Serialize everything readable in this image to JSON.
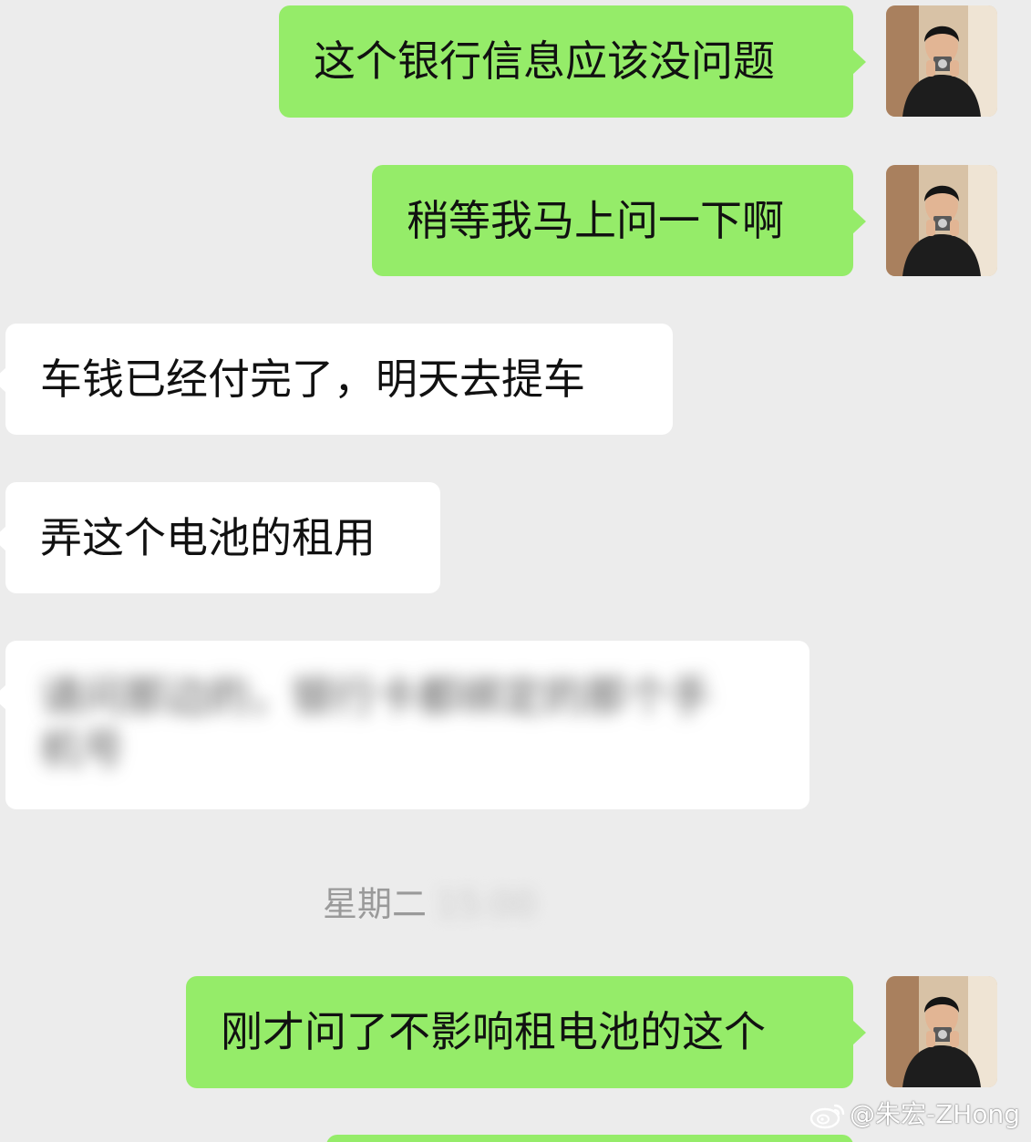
{
  "messages": [
    {
      "side": "out",
      "text": "这个银行信息应该没问题"
    },
    {
      "side": "out",
      "text": "稍等我马上问一下啊"
    },
    {
      "side": "in",
      "text": "车钱已经付完了，明天去提车"
    },
    {
      "side": "in",
      "text": "弄这个电池的租用"
    },
    {
      "side": "in",
      "line1": "请问那边的，银行卡都绑定的那个手",
      "line2": "机号"
    },
    {
      "side": "out",
      "text": "刚才问了不影响租电池的这个"
    }
  ],
  "timestamp": {
    "day": "星期二",
    "time": "15:00"
  },
  "watermark": {
    "text": "@朱宏-ZHong"
  },
  "colors": {
    "background": "#ececec",
    "outgoing_bubble": "#95ec69",
    "incoming_bubble": "#ffffff",
    "timestamp_text": "#9a9a9a"
  },
  "icons": {
    "avatar": "user-avatar-photo",
    "watermark": "weibo-logo-icon"
  }
}
